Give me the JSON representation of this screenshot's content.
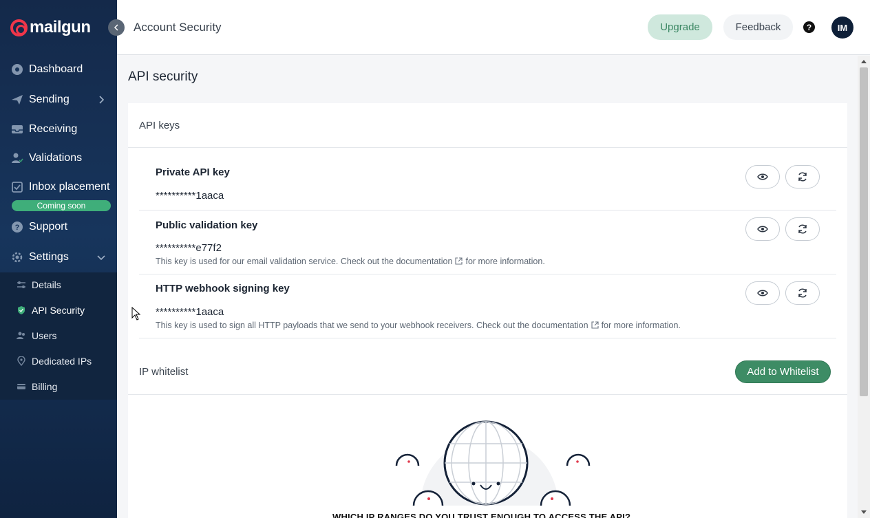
{
  "brand": {
    "name": "mailgun",
    "color": "#f0364a"
  },
  "sidebar": {
    "collapse_icon": "chevron-left-icon",
    "items": [
      {
        "label": "Dashboard",
        "icon": "dashboard-icon"
      },
      {
        "label": "Sending",
        "icon": "send-icon",
        "has_submenu": true
      },
      {
        "label": "Receiving",
        "icon": "inbox-icon"
      },
      {
        "label": "Validations",
        "icon": "user-check-icon"
      },
      {
        "label": "Inbox placement",
        "icon": "checkbox-icon",
        "badge": "Coming soon"
      },
      {
        "label": "Support",
        "icon": "help-circle-icon"
      },
      {
        "label": "Settings",
        "icon": "gear-icon",
        "expanded": true
      }
    ],
    "settings_sub": [
      {
        "label": "Details",
        "icon": "sliders-icon"
      },
      {
        "label": "API Security",
        "icon": "shield-icon",
        "active": true
      },
      {
        "label": "Users",
        "icon": "users-icon"
      },
      {
        "label": "Dedicated IPs",
        "icon": "location-pin-icon"
      },
      {
        "label": "Billing",
        "icon": "credit-card-icon"
      }
    ]
  },
  "header": {
    "title": "Account Security",
    "upgrade_label": "Upgrade",
    "feedback_label": "Feedback",
    "help_glyph": "?",
    "avatar_initials": "IM"
  },
  "main": {
    "section_title": "API security",
    "api_keys": {
      "heading": "API keys",
      "keys": [
        {
          "name": "Private API key",
          "value": "**********1aaca",
          "description": null
        },
        {
          "name": "Public validation key",
          "value": "**********e77f2",
          "description_before": "This key is used for our email validation service. Check out the documentation",
          "description_after": "for more information."
        },
        {
          "name": "HTTP webhook signing key",
          "value": "**********1aaca",
          "description_before": "This key is used to sign all HTTP payloads that we send to your webhook receivers. Check out the documentation",
          "description_after": "for more information."
        }
      ]
    },
    "ip_whitelist": {
      "heading": "IP whitelist",
      "add_label": "Add to Whitelist",
      "empty_title": "WHICH IP RANGES DO YOU TRUST ENOUGH TO ACCESS THE API?"
    }
  },
  "colors": {
    "accent_green": "#3d8c65",
    "sidebar_bg": "#14294a"
  }
}
